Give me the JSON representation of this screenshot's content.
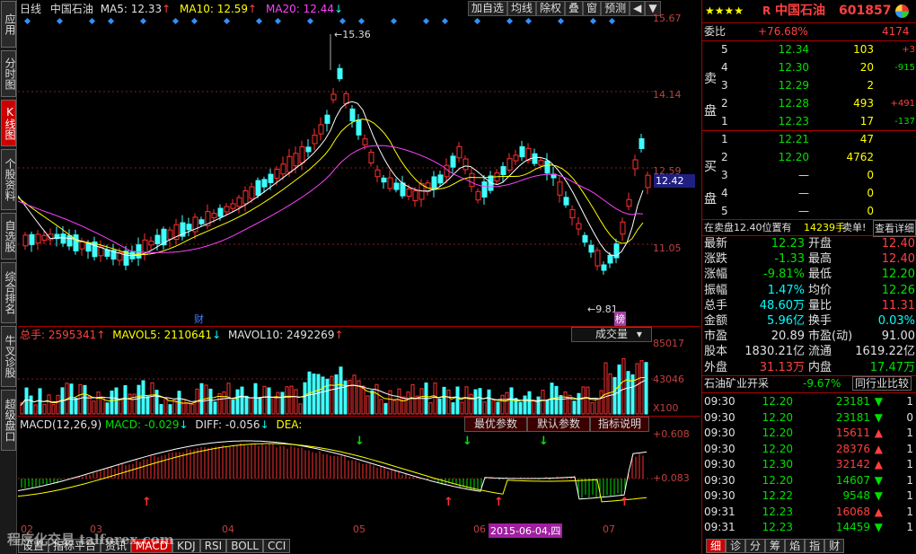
{
  "left_tabs": [
    "应用",
    "分时图",
    "K线图",
    "个股资料",
    "自选股",
    "综合排名",
    "牛叉诊股",
    "超级盘口"
  ],
  "header": {
    "period": "日线",
    "stock": "中国石油",
    "ma5": "MA5: 12.33",
    "ma10": "MA10: 12.59",
    "ma20": "MA20: 12.44",
    "buttons": [
      "加自选",
      "均线",
      "除权",
      "叠",
      "窗",
      "预测"
    ]
  },
  "price_axis": [
    "15.67",
    "14.14",
    "12.59",
    "12.42",
    "11.05"
  ],
  "annotations": {
    "high": "15.36",
    "low": "9.81",
    "cai": "财",
    "bang": "榜"
  },
  "volume": {
    "label": "总手: 2595341",
    "mavol5": "MAVOL5: 2110641",
    "mavol10": "MAVOL10: 2492269",
    "selector": "成交量",
    "axis": [
      "85017",
      "43046",
      "X100"
    ]
  },
  "macd": {
    "label": "MACD(12,26,9)",
    "macd": "MACD: -0.029",
    "diff": "DIFF: -0.056",
    "dea": "DEA:",
    "buttons": [
      "最优参数",
      "默认参数",
      "指标说明"
    ],
    "axis": [
      "+0.608",
      "+0.083"
    ]
  },
  "x_axis": [
    "02",
    "03",
    "04",
    "05",
    "06",
    "07"
  ],
  "date_tag": "2015-06-04,四",
  "bottom_tabs": [
    "设置",
    "指标平台",
    "资讯",
    "MACD",
    "KDJ",
    "RSI",
    "BOLL",
    "CCI"
  ],
  "watermark": "程序化交易 talforex.com",
  "right": {
    "stars": "★★★★",
    "r": "R",
    "name": "中国石油",
    "code": "601857",
    "weibi_label": "委比",
    "weibi": "+76.68%",
    "weicha": "4174",
    "sell_label": [
      "卖",
      "盘"
    ],
    "buy_label": [
      "买",
      "盘"
    ],
    "sells": [
      {
        "n": "5",
        "p": "12.34",
        "v": "103",
        "d": "+3"
      },
      {
        "n": "4",
        "p": "12.30",
        "v": "20",
        "d": "-915"
      },
      {
        "n": "3",
        "p": "12.29",
        "v": "2",
        "d": ""
      },
      {
        "n": "2",
        "p": "12.28",
        "v": "493",
        "d": "+491"
      },
      {
        "n": "1",
        "p": "12.23",
        "v": "17",
        "d": "-137"
      }
    ],
    "buys": [
      {
        "n": "1",
        "p": "12.21",
        "v": "47"
      },
      {
        "n": "2",
        "p": "12.20",
        "v": "4762"
      },
      {
        "n": "3",
        "p": "—",
        "v": "0"
      },
      {
        "n": "4",
        "p": "—",
        "v": "0"
      },
      {
        "n": "5",
        "p": "—",
        "v": "0"
      }
    ],
    "notice": "在卖盘12.40位置有",
    "notice_vol": "14239手",
    "notice_tail": "卖单!",
    "detail": "查看详细",
    "stats": [
      {
        "l1": "最新",
        "v1": "12.23",
        "l2": "开盘",
        "v2": "12.40",
        "c1": "grn",
        "c2": "red"
      },
      {
        "l1": "涨跌",
        "v1": "-1.33",
        "l2": "最高",
        "v2": "12.40",
        "c1": "grn",
        "c2": "red"
      },
      {
        "l1": "涨幅",
        "v1": "-9.81%",
        "l2": "最低",
        "v2": "12.20",
        "c1": "grn",
        "c2": "grn"
      },
      {
        "l1": "振幅",
        "v1": "1.47%",
        "l2": "均价",
        "v2": "12.26",
        "c1": "cyan",
        "c2": "grn"
      },
      {
        "l1": "总手",
        "v1": "48.60万",
        "l2": "量比",
        "v2": "11.31",
        "c1": "cyan",
        "c2": "red"
      },
      {
        "l1": "金额",
        "v1": "5.96亿",
        "l2": "换手",
        "v2": "0.03%",
        "c1": "cyan",
        "c2": "cyan"
      },
      {
        "l1": "市盈",
        "v1": "20.89",
        "l2": "市盈(动)",
        "v2": "91.00",
        "c1": "wht",
        "c2": "wht"
      },
      {
        "l1": "股本",
        "v1": "1830.21亿",
        "l2": "流通",
        "v2": "1619.22亿",
        "c1": "wht",
        "c2": "wht"
      },
      {
        "l1": "外盘",
        "v1": "31.13万",
        "l2": "内盘",
        "v2": "17.47万",
        "c1": "red",
        "c2": "grn"
      }
    ],
    "sector": "石油矿业开采",
    "sector_pct": "-9.67%",
    "compare": "同行业比较",
    "ticks": [
      {
        "t": "09:30",
        "p": "12.20",
        "v": "23181",
        "dir": "down",
        "e": "1"
      },
      {
        "t": "09:30",
        "p": "12.20",
        "v": "23181",
        "dir": "down",
        "e": "0"
      },
      {
        "t": "09:30",
        "p": "12.20",
        "v": "15611",
        "dir": "up",
        "e": "1"
      },
      {
        "t": "09:30",
        "p": "12.20",
        "v": "28376",
        "dir": "up",
        "e": "1"
      },
      {
        "t": "09:30",
        "p": "12.30",
        "v": "32142",
        "dir": "up",
        "e": "1"
      },
      {
        "t": "09:30",
        "p": "12.20",
        "v": "14607",
        "dir": "down",
        "e": "1"
      },
      {
        "t": "09:30",
        "p": "12.22",
        "v": "9548",
        "dir": "down",
        "e": "1"
      },
      {
        "t": "09:31",
        "p": "12.23",
        "v": "16068",
        "dir": "up",
        "e": "1"
      },
      {
        "t": "09:31",
        "p": "12.23",
        "v": "14459",
        "dir": "down",
        "e": "1"
      }
    ],
    "bottom_tabs": [
      "细",
      "诊",
      "分",
      "筹",
      "焰",
      "指",
      "财"
    ]
  }
}
